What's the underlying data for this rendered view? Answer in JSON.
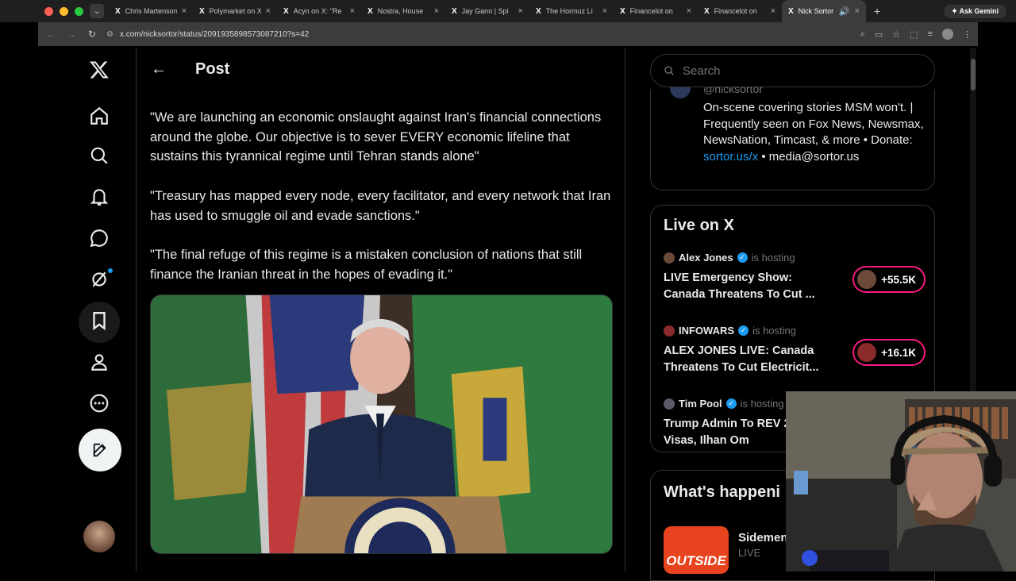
{
  "browser": {
    "tabs": [
      {
        "icon": "X",
        "title": "Chris Martenson",
        "active": false
      },
      {
        "icon": "X",
        "title": "Polymarket on X",
        "active": false
      },
      {
        "icon": "X",
        "title": "Acyn on X: \"Re",
        "active": false
      },
      {
        "icon": "X",
        "title": "Nostra, House",
        "active": false
      },
      {
        "icon": "X",
        "title": "Jay Gann | Spi",
        "active": false
      },
      {
        "icon": "X",
        "title": "The Hormuz Li",
        "active": false
      },
      {
        "icon": "X",
        "title": "Financelot on",
        "active": false
      },
      {
        "icon": "X",
        "title": "Financelot on",
        "active": false
      },
      {
        "icon": "X",
        "title": "Nick Sortor",
        "active": true
      }
    ],
    "new_tab": "+",
    "gemini_label": "Ask Gemini",
    "url": "x.com/nicksortor/status/2091935898573087210?s=42"
  },
  "post": {
    "header_title": "Post",
    "back_glyph": "←",
    "paragraphs": [
      "\"We are launching an economic onslaught against Iran's financial connections around the globe. Our objective is to sever EVERY economic lifeline that sustains this tyrannical regime until Tehran stands alone\"",
      "\"Treasury has mapped every node, every facilitator, and every network that Iran has used to smuggle oil and evade sanctions.\"",
      "\"The final refuge of this regime is a mistaken conclusion of nations that still finance the Iranian threat in the hopes of evading it.\""
    ]
  },
  "sidebar": {
    "search_placeholder": "Search",
    "bio": {
      "handle": "@nicksortor",
      "text_before_link": "On-scene covering stories MSM won't. | Frequently seen on Fox News, Newsmax, NewsNation, Timcast, & more • Donate: ",
      "link": "sortor.us/x",
      "text_after_link": " • media@sortor.us"
    },
    "live": {
      "title": "Live on X",
      "items": [
        {
          "host": "Alex Jones",
          "hosting": "is hosting",
          "title": "LIVE Emergency Show: Canada Threatens To Cut ...",
          "count": "+55.5K",
          "avatar_color": "#6b4a3a"
        },
        {
          "host": "INFOWARS",
          "hosting": "is hosting",
          "title": "ALEX JONES LIVE: Canada Threatens To Cut Electricit...",
          "count": "+16.1K",
          "avatar_color": "#8a2a2a"
        },
        {
          "host": "Tim Pool",
          "hosting": "is hosting",
          "title": "Trump Admin To REV 200k Visas, Ilhan Om",
          "count": "",
          "avatar_color": "#5a5a6a"
        }
      ]
    },
    "happening": {
      "title": "What's happeni",
      "trend_image_text": "OUTSIDE",
      "trend_name": "Sidemen",
      "trend_sub": "LIVE"
    }
  },
  "colors": {
    "accent": "#1d9bf0",
    "live_ring": "#f91880",
    "border": "#2f3336"
  }
}
